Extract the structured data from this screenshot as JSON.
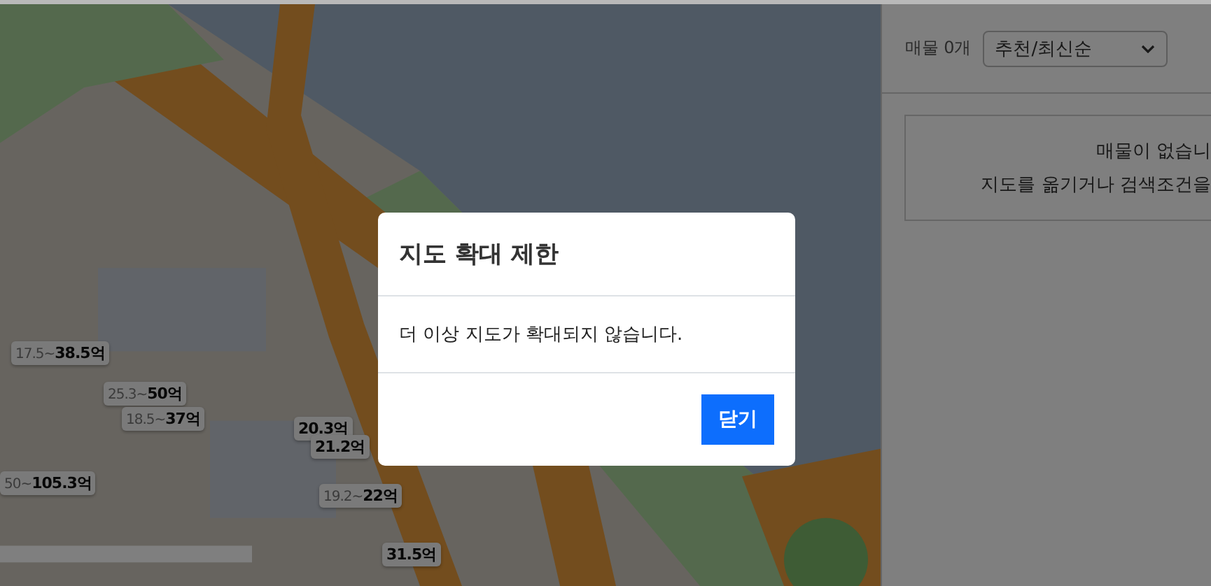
{
  "map": {
    "markers": [
      {
        "low": "17.5~",
        "high": "38.5억"
      },
      {
        "low": "25.3~",
        "high": "50억"
      },
      {
        "low": "18.5~",
        "high": "37억"
      },
      {
        "low": "50~",
        "high": "105.3억"
      },
      {
        "high": "20.3억"
      },
      {
        "high": "21.2억"
      },
      {
        "low": "19.2~",
        "high": "22억"
      },
      {
        "high": "31.5억"
      }
    ]
  },
  "panel": {
    "count": "매물 0개",
    "sort": "추천/최신순",
    "empty": [
      "매물이 없습니",
      "지도를 옮기거나 검색조건을"
    ]
  },
  "dialog": {
    "title": "지도 확대 제한",
    "message": "더 이상 지도가 확대되지 않습니다.",
    "button": "닫기"
  }
}
